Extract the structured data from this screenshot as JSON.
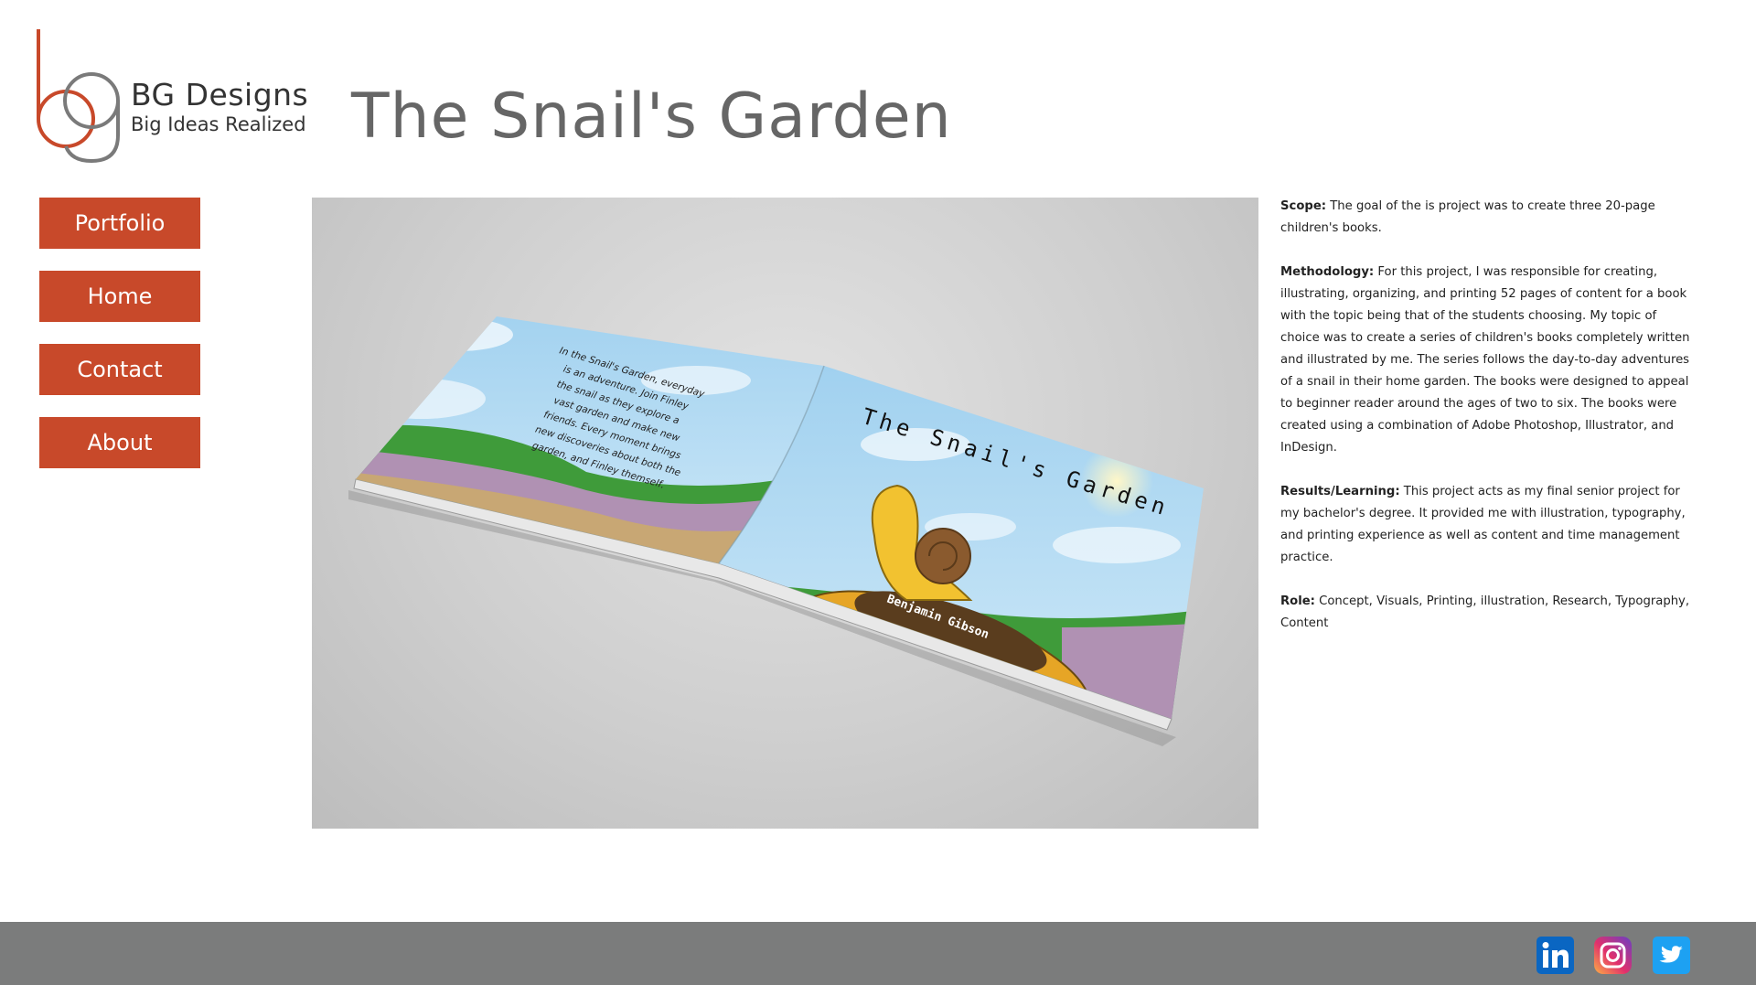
{
  "brand": {
    "name": "BG Designs",
    "tagline": "Big Ideas Realized",
    "accent_color": "#c8492a"
  },
  "page": {
    "title": "The Snail's Garden"
  },
  "nav": {
    "items": [
      {
        "label": "Portfolio"
      },
      {
        "label": "Home"
      },
      {
        "label": "Contact"
      },
      {
        "label": "About"
      }
    ]
  },
  "book": {
    "cover_title": "The Snail's Garden",
    "author": "Benjamin Gibson",
    "back_blurb": [
      "In the Snail's Garden, everyday",
      "is an adventure. Join Finley",
      "the snail as they explore a",
      "vast garden and make new",
      "friends. Every moment brings",
      "new discoveries about both the",
      "garden, and Finley themself."
    ]
  },
  "description": {
    "scope_label": "Scope:",
    "scope_text": " The goal of the is project was to create three 20-page children's books.",
    "methodology_label": "Methodology:",
    "methodology_text": " For this project, I was responsible for creating, illustrating, organizing, and printing 52 pages of content for a book with the topic being that of the students choosing. My topic of choice was to create a series of children's books completely written and illustrated by me. The series follows the day-to-day adventures of a snail in their home garden. The books were designed to appeal to beginner reader around the ages of two to six. The books were created using a combination of Adobe Photoshop, Illustrator, and InDesign.",
    "results_label": "Results/Learning:",
    "results_text": " This project acts as my final senior project for my bachelor's degree. It provided me with illustration, typography, and printing experience as well as content and time management practice.",
    "role_label": "Role:",
    "role_text": " Concept, Visuals, Printing, illustration, Research, Typography, Content"
  },
  "footer": {
    "background_color": "#7b7c7c",
    "social": [
      {
        "icon": "linkedin-icon",
        "color": "#0a66c2"
      },
      {
        "icon": "instagram-icon",
        "color": "#d6296e"
      },
      {
        "icon": "twitter-icon",
        "color": "#1da1f2"
      }
    ]
  }
}
